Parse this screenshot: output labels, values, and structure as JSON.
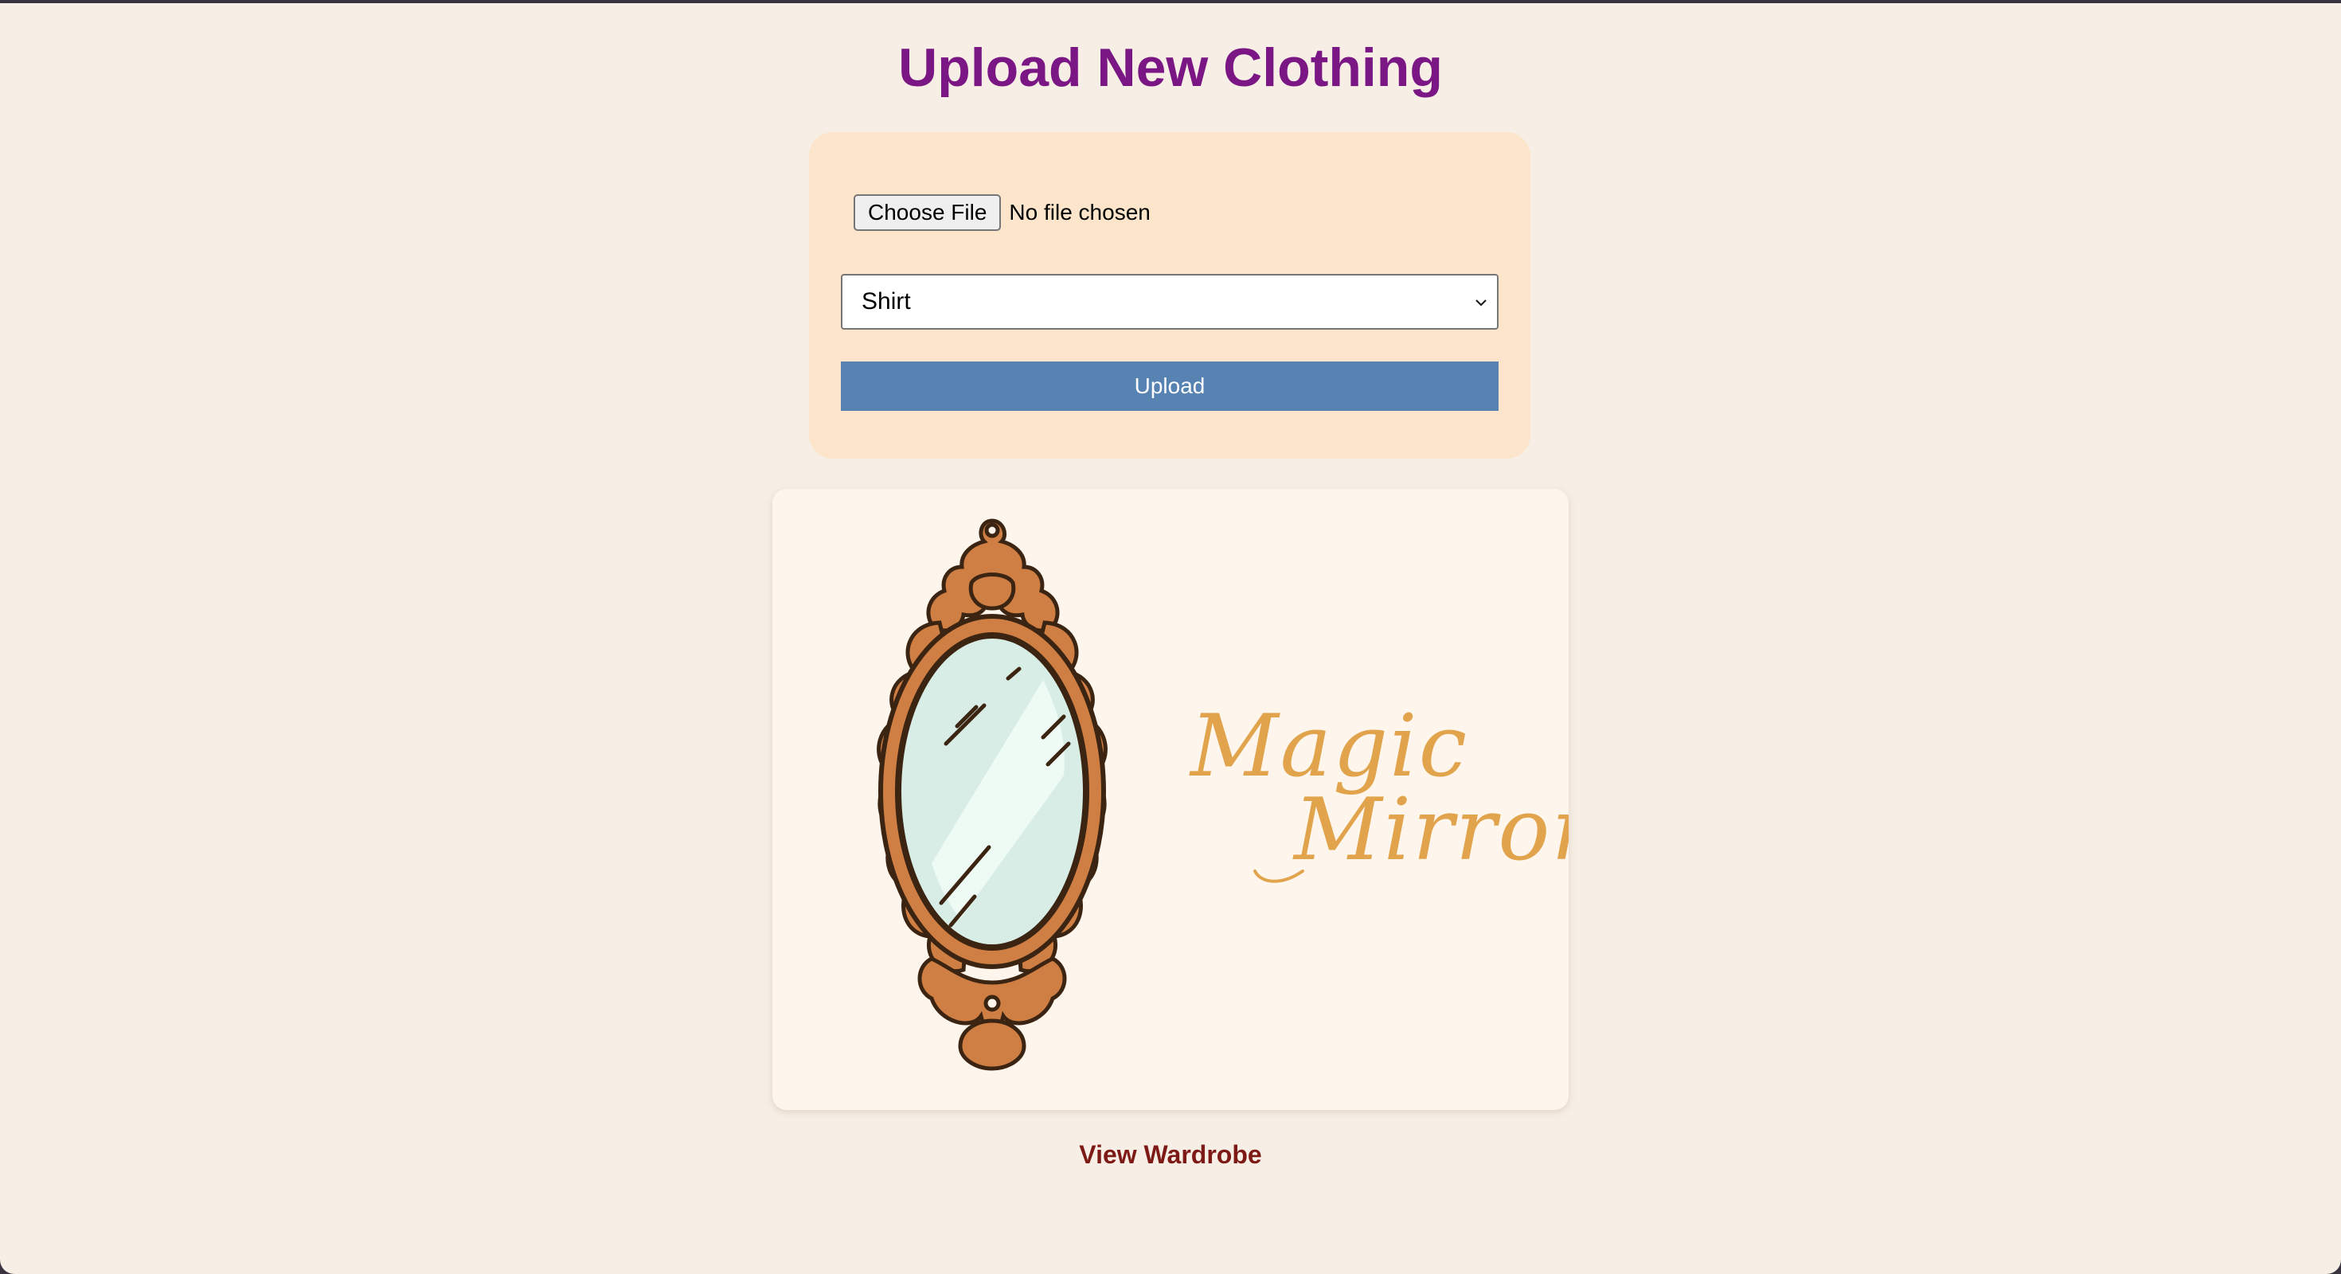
{
  "page": {
    "title": "Upload New Clothing"
  },
  "upload_form": {
    "file_button_label": "Choose File",
    "file_status": "No file chosen",
    "category_selected": "Shirt",
    "submit_label": "Upload"
  },
  "banner": {
    "line1": "Magic",
    "line2": "Mirror",
    "icon": "ornate-mirror-icon"
  },
  "footer_link": {
    "label": "View Wardrobe"
  },
  "colors": {
    "title": "#7b1685",
    "card_background": "#fce5ca",
    "upload_button": "#5783b3",
    "page_background": "#f7efe6",
    "brand_text": "#e1a44c",
    "link": "#7e1a16"
  }
}
